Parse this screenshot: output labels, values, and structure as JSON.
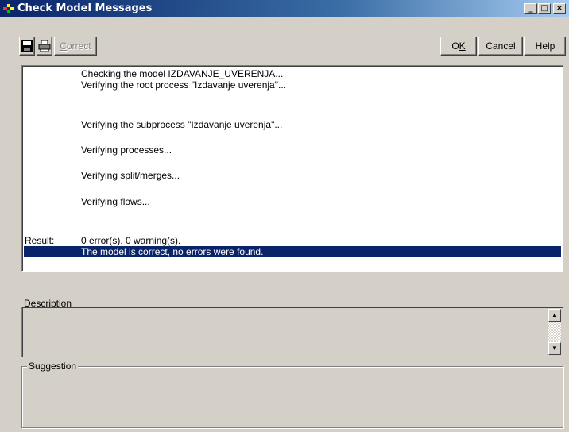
{
  "window": {
    "title": "Check Model Messages",
    "title_bar_color": "#0a246a",
    "controls": {
      "minimize": "_",
      "maximize": "□",
      "close": "×"
    }
  },
  "toolbar": {
    "save_icon": "floppy-disk-icon",
    "print_icon": "printer-icon",
    "correct_label": "Correct",
    "ok_label": "OK",
    "cancel_label": "Cancel",
    "help_label": "Help"
  },
  "messages": {
    "lines": [
      "Checking the model IZDAVANJE_UVERENJA...",
      "Verifying the root process \"Izdavanje uverenja\"...",
      "Verifying the subprocess \"Izdavanje uverenja\"...",
      "Verifying processes...",
      "Verifying split/merges...",
      "Verifying flows..."
    ],
    "result_label": "Result:",
    "result_text": "0 error(s), 0 warning(s).",
    "final_message": "The model is correct, no errors were found.",
    "selection_color": "#0a246a"
  },
  "description": {
    "label": "Description",
    "text": ""
  },
  "suggestion": {
    "label": "Suggestion",
    "text": ""
  }
}
